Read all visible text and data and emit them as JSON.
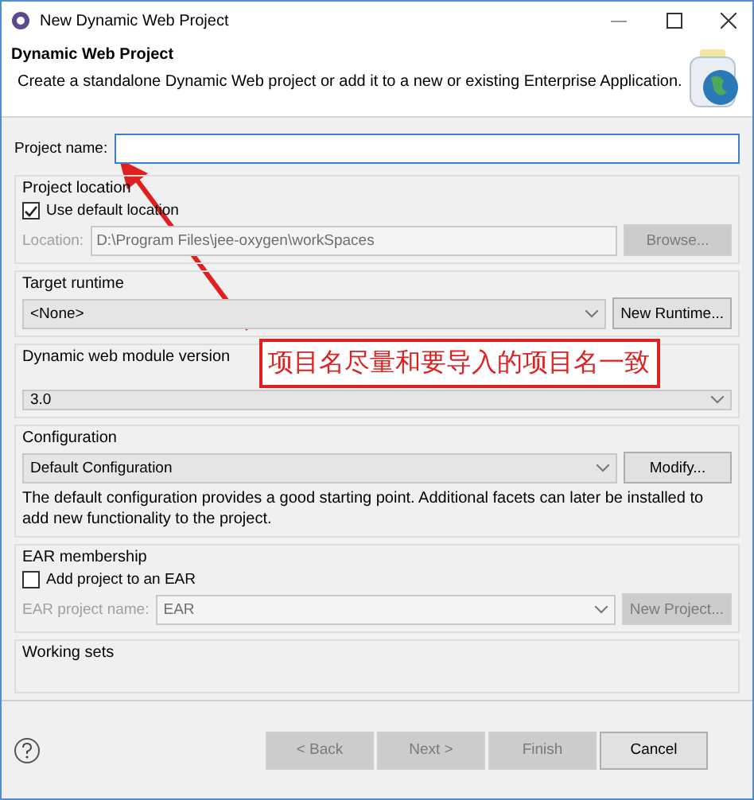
{
  "window": {
    "title": "New Dynamic Web Project"
  },
  "header": {
    "title": "Dynamic Web Project",
    "description": "Create a standalone Dynamic Web project or add it to a new or existing Enterprise Application."
  },
  "project_name": {
    "label": "Project name:"
  },
  "project_location": {
    "title": "Project location",
    "use_default": {
      "label": "Use default location",
      "checked": true
    },
    "location": {
      "label": "Location:",
      "value": "D:\\Program Files\\jee-oxygen\\workSpaces",
      "disabled": true
    },
    "browse": {
      "label": "Browse...",
      "disabled": true
    }
  },
  "target_runtime": {
    "title": "Target runtime",
    "value": "<None>",
    "button": "New Runtime..."
  },
  "module_version": {
    "title": "Dynamic web module version",
    "value": "3.0"
  },
  "configuration": {
    "title": "Configuration",
    "value": "Default Configuration",
    "button": "Modify...",
    "description": "The default configuration provides a good starting point. Additional facets can later be installed to add new functionality to the project."
  },
  "ear_membership": {
    "title": "EAR membership",
    "add": {
      "label": "Add project to an EAR",
      "checked": false
    },
    "ear_name": {
      "label": "EAR project name:",
      "value": "EAR",
      "disabled": true
    },
    "new_project": {
      "label": "New Project...",
      "disabled": true
    }
  },
  "working_sets": {
    "title": "Working sets"
  },
  "annotation": {
    "text": "项目名尽量和要导入的项目名一致"
  },
  "buttons": [
    {
      "label": "< Back",
      "disabled": true
    },
    {
      "label": "Next >",
      "disabled": true
    },
    {
      "label": "Finish",
      "disabled": true
    },
    {
      "label": "Cancel",
      "disabled": false
    }
  ]
}
